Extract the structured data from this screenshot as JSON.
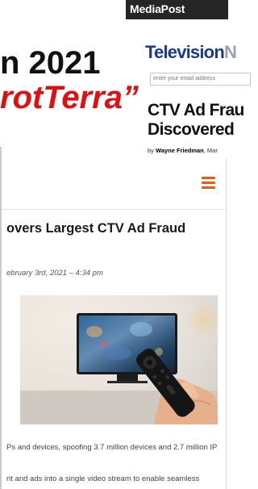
{
  "mediapost": {
    "brand": "MediaPost",
    "section_brand": "Television",
    "section_brand_tail": "N",
    "email_placeholder": "enter your email address",
    "headline_line1": "CTV Ad Frau",
    "headline_line2": "Discovered",
    "byline_prefix": "by",
    "byline_author": "Wayne Friedman",
    "byline_suffix": ", Mar"
  },
  "slide": {
    "title": "n 2021",
    "highlight": "rotTerra”"
  },
  "article": {
    "headline": "overs Largest CTV Ad Fraud",
    "date": "ebruary 3rd, 2021 – 4:34 pm",
    "body_line1": "Ps and devices, spoofing 3.7 million devices and 2.7 million IP",
    "body_line2": "nt and ads into a single video stream to enable seamless"
  },
  "colors": {
    "menu_accent": "#ea5b0c",
    "television_blue": "#1b3a8f",
    "slide_red": "#e01010"
  },
  "icons": {
    "menu": "hamburger-menu-icon",
    "photo": "tv-remote-photo"
  }
}
